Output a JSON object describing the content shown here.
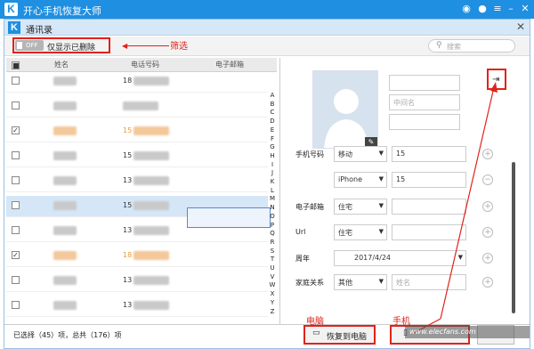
{
  "app": {
    "title": "开心手机恢复大师",
    "logo_letter": "K"
  },
  "window_icons": [
    "wechat-icon",
    "message-icon",
    "menu-icon",
    "minimize-icon",
    "close-icon"
  ],
  "dialog": {
    "title": "通讯录",
    "logo_letter": "K",
    "close_glyph": "✕"
  },
  "toolbar": {
    "toggle_label": "OFF",
    "only_deleted_label": "仅显示已删除",
    "search_placeholder": "搜索"
  },
  "annotations": {
    "filter": "筛选",
    "computer": "电脑",
    "phone": "手机"
  },
  "table": {
    "columns": [
      "姓名",
      "电话号码",
      "电子邮箱"
    ],
    "rows": [
      {
        "checked": false,
        "phone": "18",
        "deleted": false,
        "selected": false
      },
      {
        "checked": false,
        "phone": "",
        "deleted": false,
        "selected": false
      },
      {
        "checked": true,
        "phone": "15",
        "deleted": true,
        "selected": false
      },
      {
        "checked": false,
        "phone": "15",
        "deleted": false,
        "selected": false
      },
      {
        "checked": false,
        "phone": "13",
        "deleted": false,
        "selected": false
      },
      {
        "checked": false,
        "phone": "15",
        "deleted": false,
        "selected": true
      },
      {
        "checked": false,
        "phone": "13",
        "deleted": false,
        "selected": false
      },
      {
        "checked": true,
        "phone": "18",
        "deleted": true,
        "selected": false
      },
      {
        "checked": false,
        "phone": "13",
        "deleted": false,
        "selected": false
      },
      {
        "checked": false,
        "phone": "13",
        "deleted": false,
        "selected": false
      }
    ]
  },
  "alphabet": [
    "A",
    "B",
    "C",
    "D",
    "E",
    "F",
    "G",
    "H",
    "I",
    "J",
    "K",
    "L",
    "M",
    "N",
    "O",
    "P",
    "Q",
    "R",
    "S",
    "T",
    "U",
    "V",
    "W",
    "X",
    "Y",
    "Z"
  ],
  "status": "已选择（45）项，总共（176）项",
  "detail": {
    "middle_name_placeholder": "中间名",
    "last_name_placeholder": "姓名",
    "phone_label": "手机号码",
    "phone_type_1": "移动",
    "phone_value_1": "15",
    "phone_type_2": "iPhone",
    "phone_value_2": "15",
    "email_label": "电子邮箱",
    "email_type": "住宅",
    "url_label": "Url",
    "url_type": "住宅",
    "anniversary_label": "周年",
    "anniversary_value": "2017/4/24",
    "family_label": "家庭关系",
    "family_type": "其他"
  },
  "buttons": {
    "restore_to_pc": "恢复到电脑"
  },
  "watermark": "www.elecfans.com",
  "colors": {
    "title_bar": "#1e8fe1",
    "annotation_red": "#e0231b",
    "selected_row": "#d5e6f7"
  }
}
